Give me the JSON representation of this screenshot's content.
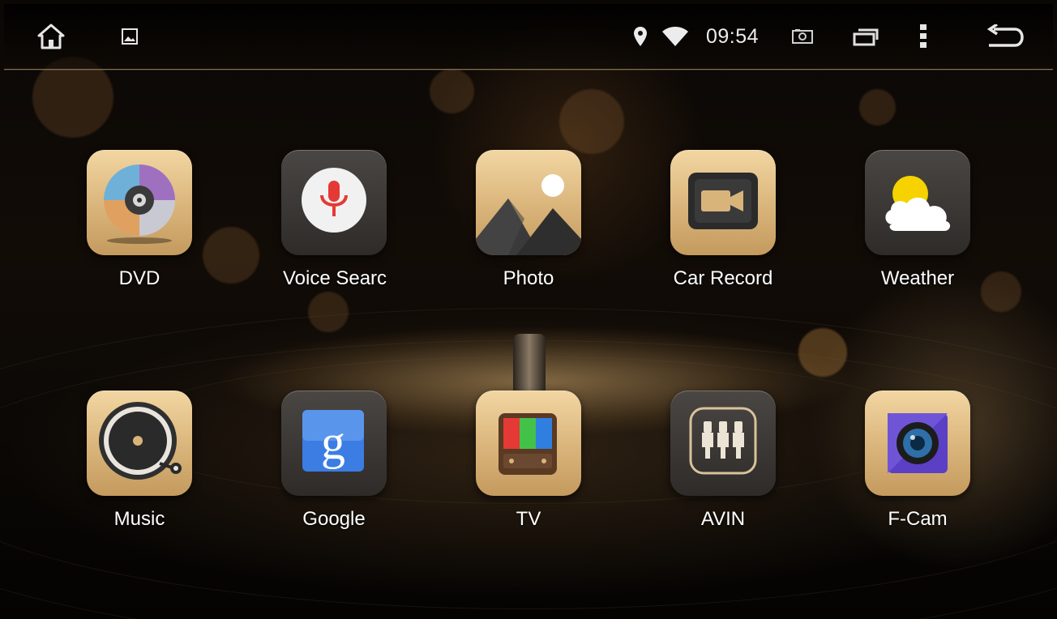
{
  "statusbar": {
    "time": "09:54",
    "left_icons": [
      "home-icon",
      "gallery-icon"
    ],
    "right_icons": [
      "location-icon",
      "wifi-icon",
      "screenshot-icon",
      "recent-apps-icon",
      "menu-icon",
      "back-icon"
    ]
  },
  "apps": [
    {
      "label": "DVD",
      "icon": "dvd-disc-icon"
    },
    {
      "label": "Voice Searc",
      "icon": "microphone-icon"
    },
    {
      "label": "Photo",
      "icon": "photo-mountain-icon"
    },
    {
      "label": "Car Record",
      "icon": "video-camera-icon"
    },
    {
      "label": "Weather",
      "icon": "weather-cloud-sun-icon"
    },
    {
      "label": "Music",
      "icon": "vinyl-record-icon"
    },
    {
      "label": "Google",
      "icon": "google-g-icon"
    },
    {
      "label": "TV",
      "icon": "tv-icon"
    },
    {
      "label": "AVIN",
      "icon": "rca-jack-icon"
    },
    {
      "label": "F-Cam",
      "icon": "camera-lens-icon"
    }
  ],
  "colors": {
    "gold_tile": "#d9b47a",
    "dark_tile": "#2e2b29",
    "mic_red": "#e53935",
    "google_blue": "#3b7de3",
    "fcam_purple": "#5b3fc4"
  }
}
